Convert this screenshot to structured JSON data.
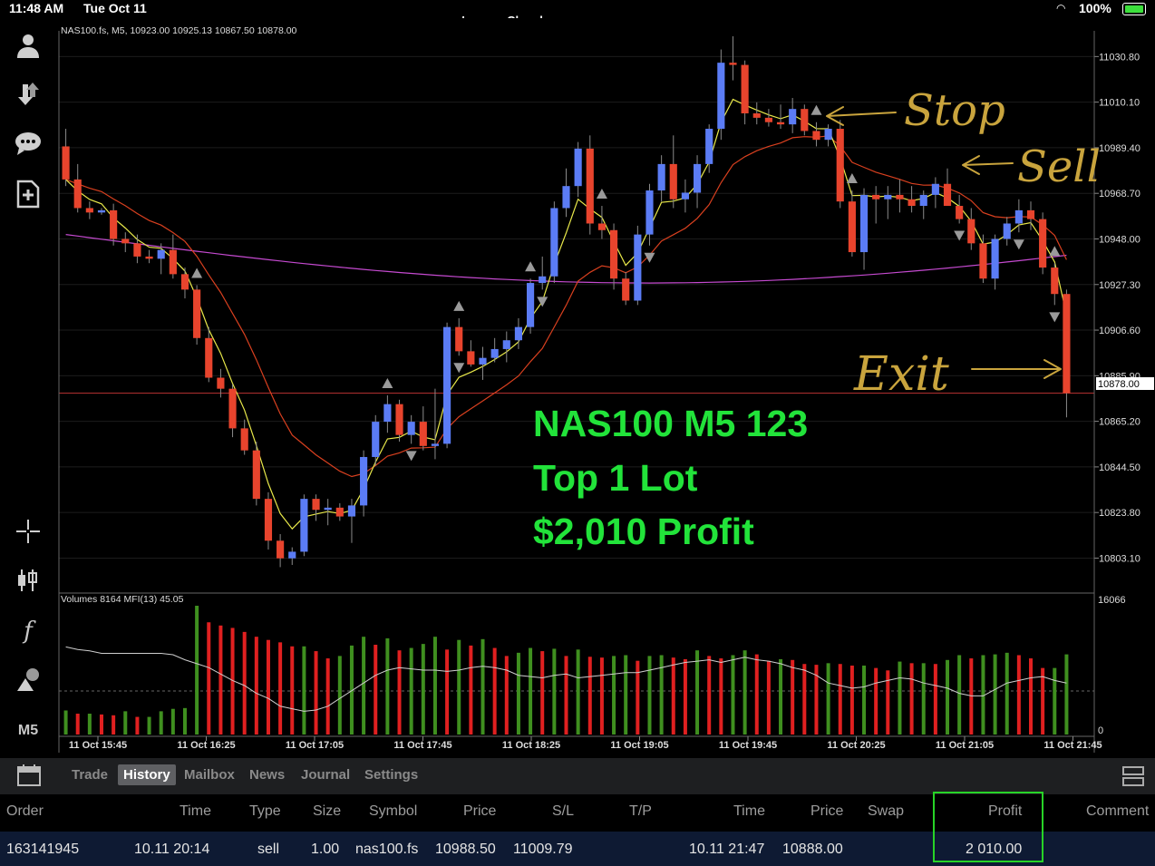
{
  "status_bar": {
    "time": "11:48 AM",
    "date": "Tue Oct 11",
    "battery": "100%",
    "account": "Lennox Chambers"
  },
  "chart": {
    "header": "NAS100.fs, M5, 10923.00 10925.13 10867.50 10878.00",
    "sub_header": "Volumes 8164 MFI(13) 45.05",
    "price_labels": [
      "11030.80",
      "11010.10",
      "10989.40",
      "10968.70",
      "10948.00",
      "10927.30",
      "10906.60",
      "10885.90",
      "10865.20",
      "10844.50",
      "10823.80",
      "10803.10"
    ],
    "current_price": "10878.00",
    "volume_labels": [
      "16066",
      "0"
    ],
    "time_labels": [
      "11 Oct 15:45",
      "11 Oct 16:25",
      "11 Oct 17:05",
      "11 Oct 17:45",
      "11 Oct 18:25",
      "11 Oct 19:05",
      "11 Oct 19:45",
      "11 Oct 20:25",
      "11 Oct 21:05",
      "11 Oct 21:45"
    ],
    "overlay_text": {
      "line1": "NAS100 M5 123",
      "line2": "Top 1 Lot",
      "line3": "$2,010 Profit"
    },
    "annotations": {
      "stop": "Stop",
      "sell": "Sell",
      "exit": "Exit"
    },
    "colors": {
      "bull": "#5b7cf5",
      "bear": "#e8442d",
      "vol_up": "#3f8f1f",
      "vol_down": "#e02020",
      "ma_fast": "#e8e84a",
      "ma_mid": "#d9401f",
      "ma_slow": "#c54ad0",
      "overlay": "#22e33a",
      "scribble": "#c9a43d"
    }
  },
  "chart_data": {
    "type": "candlestick",
    "symbol": "NAS100.fs",
    "timeframe": "M5",
    "y_range": [
      10793,
      11040
    ],
    "candles": [
      [
        10990,
        10998,
        10972,
        10975
      ],
      [
        10975,
        10982,
        10960,
        10962
      ],
      [
        10962,
        10965,
        10957,
        10960
      ],
      [
        10960,
        10962,
        10959,
        10961
      ],
      [
        10961,
        10964,
        10945,
        10948
      ],
      [
        10948,
        10951,
        10942,
        10946
      ],
      [
        10946,
        10950,
        10937,
        10940
      ],
      [
        10940,
        10943,
        10937,
        10939
      ],
      [
        10939,
        10946,
        10932,
        10943
      ],
      [
        10943,
        10950,
        10930,
        10932
      ],
      [
        10932,
        10935,
        10921,
        10925
      ],
      [
        10925,
        10927,
        10900,
        10903
      ],
      [
        10903,
        10908,
        10883,
        10885
      ],
      [
        10885,
        10889,
        10876,
        10880
      ],
      [
        10880,
        10882,
        10858,
        10862
      ],
      [
        10862,
        10866,
        10850,
        10852
      ],
      [
        10852,
        10856,
        10827,
        10830
      ],
      [
        10830,
        10833,
        10807,
        10811
      ],
      [
        10811,
        10814,
        10799,
        10803
      ],
      [
        10803,
        10808,
        10800,
        10806
      ],
      [
        10806,
        10832,
        10804,
        10830
      ],
      [
        10830,
        10832,
        10820,
        10825
      ],
      [
        10825,
        10830,
        10818,
        10826
      ],
      [
        10826,
        10828,
        10820,
        10822
      ],
      [
        10822,
        10830,
        10810,
        10827
      ],
      [
        10827,
        10852,
        10822,
        10849
      ],
      [
        10849,
        10868,
        10845,
        10865
      ],
      [
        10865,
        10877,
        10860,
        10873
      ],
      [
        10873,
        10875,
        10856,
        10859
      ],
      [
        10859,
        10868,
        10855,
        10865
      ],
      [
        10865,
        10872,
        10852,
        10854
      ],
      [
        10854,
        10880,
        10848,
        10855
      ],
      [
        10855,
        10910,
        10853,
        10908
      ],
      [
        10908,
        10912,
        10895,
        10897
      ],
      [
        10897,
        10902,
        10890,
        10891
      ],
      [
        10891,
        10899,
        10884,
        10894
      ],
      [
        10894,
        10903,
        10892,
        10898
      ],
      [
        10898,
        10906,
        10892,
        10902
      ],
      [
        10902,
        10912,
        10898,
        10908
      ],
      [
        10908,
        10930,
        10905,
        10928
      ],
      [
        10928,
        10940,
        10925,
        10931
      ],
      [
        10931,
        10965,
        10928,
        10962
      ],
      [
        10962,
        10980,
        10958,
        10972
      ],
      [
        10972,
        10992,
        10967,
        10989
      ],
      [
        10989,
        10995,
        10950,
        10955
      ],
      [
        10955,
        10963,
        10948,
        10952
      ],
      [
        10952,
        10955,
        10925,
        10930
      ],
      [
        10930,
        10933,
        10918,
        10920
      ],
      [
        10920,
        10954,
        10918,
        10950
      ],
      [
        10950,
        10973,
        10945,
        10970
      ],
      [
        10970,
        10986,
        10965,
        10982
      ],
      [
        10982,
        10995,
        10962,
        10966
      ],
      [
        10966,
        10975,
        10960,
        10969
      ],
      [
        10969,
        10986,
        10962,
        10982
      ],
      [
        10982,
        11000,
        10978,
        10998
      ],
      [
        10998,
        11034,
        10993,
        11028
      ],
      [
        11028,
        11040,
        11020,
        11027
      ],
      [
        11027,
        11029,
        11000,
        11005
      ],
      [
        11005,
        11010,
        11000,
        11003
      ],
      [
        11003,
        11007,
        10999,
        11001
      ],
      [
        11001,
        11009,
        10998,
        11000
      ],
      [
        11000,
        11012,
        10996,
        11007
      ],
      [
        11007,
        11009,
        10995,
        10997
      ],
      [
        10997,
        11001,
        10990,
        10993
      ],
      [
        10993,
        11000,
        10990,
        10998
      ],
      [
        10998,
        11002,
        10962,
        10965
      ],
      [
        10965,
        10970,
        10940,
        10942
      ],
      [
        10942,
        10971,
        10934,
        10968
      ],
      [
        10968,
        10972,
        10955,
        10966
      ],
      [
        10966,
        10972,
        10957,
        10968
      ],
      [
        10968,
        10975,
        10960,
        10966
      ],
      [
        10966,
        10972,
        10960,
        10963
      ],
      [
        10963,
        10970,
        10957,
        10968
      ],
      [
        10968,
        10976,
        10962,
        10973
      ],
      [
        10973,
        10980,
        10965,
        10963
      ],
      [
        10963,
        10968,
        10955,
        10957
      ],
      [
        10957,
        10962,
        10943,
        10946
      ],
      [
        10946,
        10950,
        10928,
        10930
      ],
      [
        10930,
        10950,
        10925,
        10948
      ],
      [
        10948,
        10958,
        10945,
        10955
      ],
      [
        10955,
        10966,
        10951,
        10961
      ],
      [
        10961,
        10965,
        10952,
        10957
      ],
      [
        10957,
        10960,
        10932,
        10935
      ],
      [
        10935,
        10937,
        10918,
        10923
      ],
      [
        10923,
        10925,
        10867,
        10878
      ]
    ],
    "arrows_up_idx": [
      11,
      27,
      33,
      39,
      45,
      63,
      66,
      83,
      92
    ],
    "arrows_down_idx": [
      29,
      33,
      40,
      49,
      75,
      80,
      83,
      92
    ],
    "volumes": [
      3000,
      2600,
      2600,
      2500,
      2400,
      2900,
      2200,
      2200,
      2900,
      3200,
      3300,
      16066,
      14000,
      13600,
      13300,
      12800,
      12200,
      11800,
      11500,
      11000,
      11000,
      10400,
      9500,
      9800,
      11100,
      12200,
      11200,
      12000,
      10500,
      10800,
      11300,
      12200,
      10600,
      11800,
      11100,
      11900,
      10800,
      9800,
      10200,
      10800,
      10400,
      10700,
      9800,
      10600,
      9700,
      9600,
      9800,
      9900,
      9200,
      9800,
      9900,
      9600,
      9400,
      10500,
      9800,
      9500,
      9900,
      10500,
      10000,
      9200,
      9400,
      9300,
      8800,
      8700,
      8900,
      8800,
      8600,
      8600,
      8300,
      8000,
      9100,
      8900,
      8900,
      8800,
      9300,
      9900,
      9500,
      9900,
      10000,
      10200,
      9900,
      9500,
      8300,
      8300,
      10000
    ],
    "mfi": [
      68,
      66,
      65,
      63,
      63,
      63,
      63,
      63,
      63,
      62,
      58,
      55,
      52,
      47,
      42,
      38,
      32,
      28,
      22,
      20,
      18,
      19,
      22,
      28,
      34,
      40,
      46,
      50,
      52,
      51,
      50,
      50,
      49,
      50,
      52,
      53,
      52,
      50,
      46,
      45,
      44,
      46,
      47,
      44,
      45,
      46,
      47,
      48,
      48,
      50,
      52,
      54,
      56,
      57,
      58,
      56,
      58,
      60,
      58,
      57,
      55,
      52,
      50,
      46,
      40,
      38,
      36,
      37,
      40,
      42,
      44,
      43,
      40,
      38,
      36,
      32,
      30,
      30,
      35,
      40,
      42,
      44,
      45,
      42,
      40,
      38,
      35
    ],
    "series": [
      {
        "name": "MA fast",
        "color": "#e8e84a"
      },
      {
        "name": "MA mid",
        "color": "#d9401f"
      },
      {
        "name": "MA slow",
        "color": "#c54ad0"
      },
      {
        "name": "MFI(13)",
        "color": "#cfcfcf"
      }
    ]
  },
  "toolbar": {
    "tabs": [
      "Trade",
      "History",
      "Mailbox",
      "News",
      "Journal",
      "Settings"
    ],
    "active_tab": "History",
    "timeframe_label": "M5"
  },
  "history": {
    "columns": {
      "order": "Order",
      "time": "Time",
      "type": "Type",
      "size": "Size",
      "symbol": "Symbol",
      "price": "Price",
      "sl": "S/L",
      "tp": "T/P",
      "time2": "Time",
      "price2": "Price",
      "swap": "Swap",
      "profit": "Profit",
      "comment": "Comment"
    },
    "row": {
      "order": "163141945",
      "time": "10.11 20:14",
      "type": "sell",
      "size": "1.00",
      "symbol": "nas100.fs",
      "price": "10988.50",
      "sl": "11009.79",
      "tp": "",
      "time2": "10.11 21:47",
      "price2": "10888.00",
      "swap": "",
      "profit": "2 010.00",
      "comment": ""
    }
  }
}
